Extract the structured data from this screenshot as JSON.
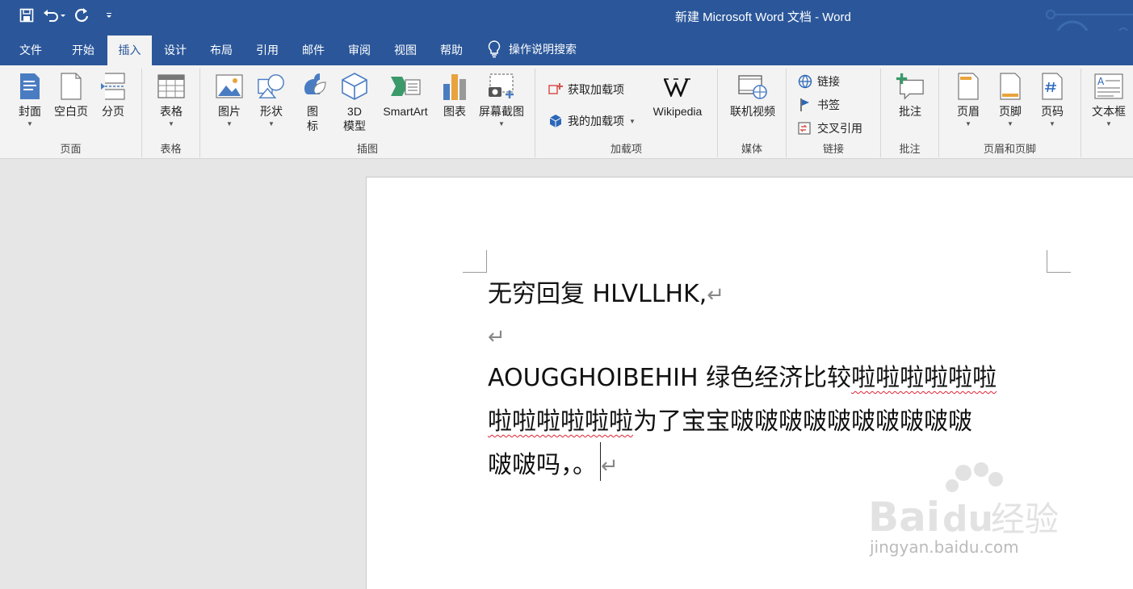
{
  "title_bar": {
    "title": "新建 Microsoft Word 文档  -  Word"
  },
  "tabs": [
    {
      "label": "文件"
    },
    {
      "label": "开始"
    },
    {
      "label": "插入",
      "active": true
    },
    {
      "label": "设计"
    },
    {
      "label": "布局"
    },
    {
      "label": "引用"
    },
    {
      "label": "邮件"
    },
    {
      "label": "审阅"
    },
    {
      "label": "视图"
    },
    {
      "label": "帮助"
    }
  ],
  "search": {
    "label": "操作说明搜索",
    "icon": "lightbulb-icon"
  },
  "ribbon": {
    "pages_group": {
      "label": "页面",
      "cover": "封面",
      "blank": "空白页",
      "break": "分页"
    },
    "table_group": {
      "label": "表格",
      "table": "表格"
    },
    "illustrations_group": {
      "label": "插图",
      "pictures": "图片",
      "shapes": "形状",
      "icons_line1": "图",
      "icons_line2": "标",
      "model_line1": "3D",
      "model_line2": "模型",
      "smartart": "SmartArt",
      "chart": "图表",
      "screenshot": "屏幕截图"
    },
    "addins_group": {
      "label": "加载项",
      "get": "获取加载项",
      "my": "我的加载项",
      "wikipedia": "Wikipedia"
    },
    "media_group": {
      "label": "媒体",
      "video": "联机视频"
    },
    "links_group": {
      "label": "链接",
      "link": "链接",
      "bookmark": "书签",
      "crossref": "交叉引用"
    },
    "comments_group": {
      "label": "批注",
      "comment": "批注"
    },
    "header_footer_group": {
      "label": "页眉和页脚",
      "header": "页眉",
      "footer": "页脚",
      "page_number": "页码"
    },
    "text_group": {
      "textbox": "文本框"
    }
  },
  "document": {
    "line1": "无穷回复 HLVLLHK,",
    "para2_line1_a": "AOUGGHOIBEHIH 绿色经济比较",
    "para2_line1_b": "啦啦啦啦啦啦",
    "para2_line2_a": "啦啦啦啦啦啦",
    "para2_line2_b": "为了宝宝啵啵啵啵啵啵啵啵啵啵",
    "para2_line3": "啵啵吗，。",
    "para_mark": "↵"
  },
  "watermark": {
    "text": "jingyan.baidu.com",
    "logo_a": "Bai",
    "logo_b": "du",
    "logo_c": "经验"
  }
}
